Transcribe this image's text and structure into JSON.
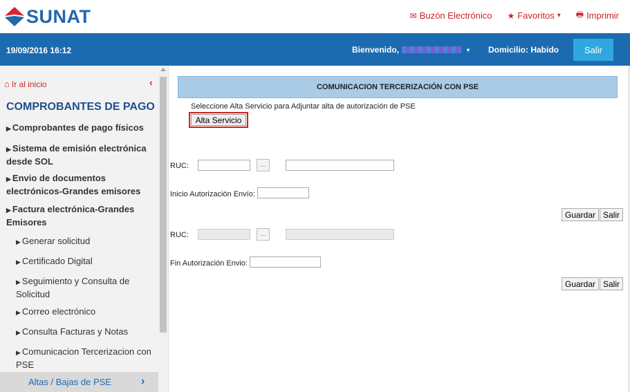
{
  "header": {
    "logo_text": "SUNAT",
    "links": [
      {
        "icon": "envelope-icon",
        "label": "Buzón Electrónico"
      },
      {
        "icon": "star-icon",
        "label": "Favoritos",
        "caret": "▾"
      },
      {
        "icon": "printer-icon",
        "label": "Imprimir"
      }
    ]
  },
  "bar": {
    "datetime": "19/09/2016 16:12",
    "welcome": "Bienvenido,",
    "welcome_caret": "▾",
    "domicilio": "Domicilio: Habido",
    "logout": "Salir"
  },
  "sidebar": {
    "home": "Ir al inicio",
    "title": "COMPROBANTES DE PAGO",
    "items": [
      "Comprobantes de pago físicos",
      "Sistema de emisión electrónica desde SOL",
      "Envio de documentos electrónicos-Grandes emisores",
      "Factura electrónica-Grandes Emisores"
    ],
    "subitems": [
      "Generar solicitud",
      "Certificado Digital",
      "Seguimiento y Consulta de Solicitud",
      "Correo electrónico",
      "Consulta Facturas y Notas",
      "Comunicacion Tercerizacion con PSE"
    ],
    "active": "Altas / Bajas de PSE"
  },
  "main": {
    "panel_title": "COMUNICACION TERCERIZACIÓN CON PSE",
    "hint": "Seleccione Alta Servicio para Adjuntar alta de autorización de PSE",
    "alta_button": "Alta Servicio",
    "form1": {
      "ruc_label": "RUC:",
      "ruc_value": "",
      "dots": "...",
      "name_value": "",
      "date_label": "Inicio Autorización Envío:",
      "date_value": "",
      "save": "Guardar",
      "exit": "Salir"
    },
    "form2": {
      "ruc_label": "RUC:",
      "ruc_value": "",
      "dots": "...",
      "name_value": "",
      "date_label": "Fin Autorización Envio:",
      "date_value": "",
      "save": "Guardar",
      "exit": "Salir"
    }
  },
  "colors": {
    "brand_blue": "#1c6bb0",
    "brand_red": "#c9252c",
    "panel": "#a9cbe6"
  }
}
